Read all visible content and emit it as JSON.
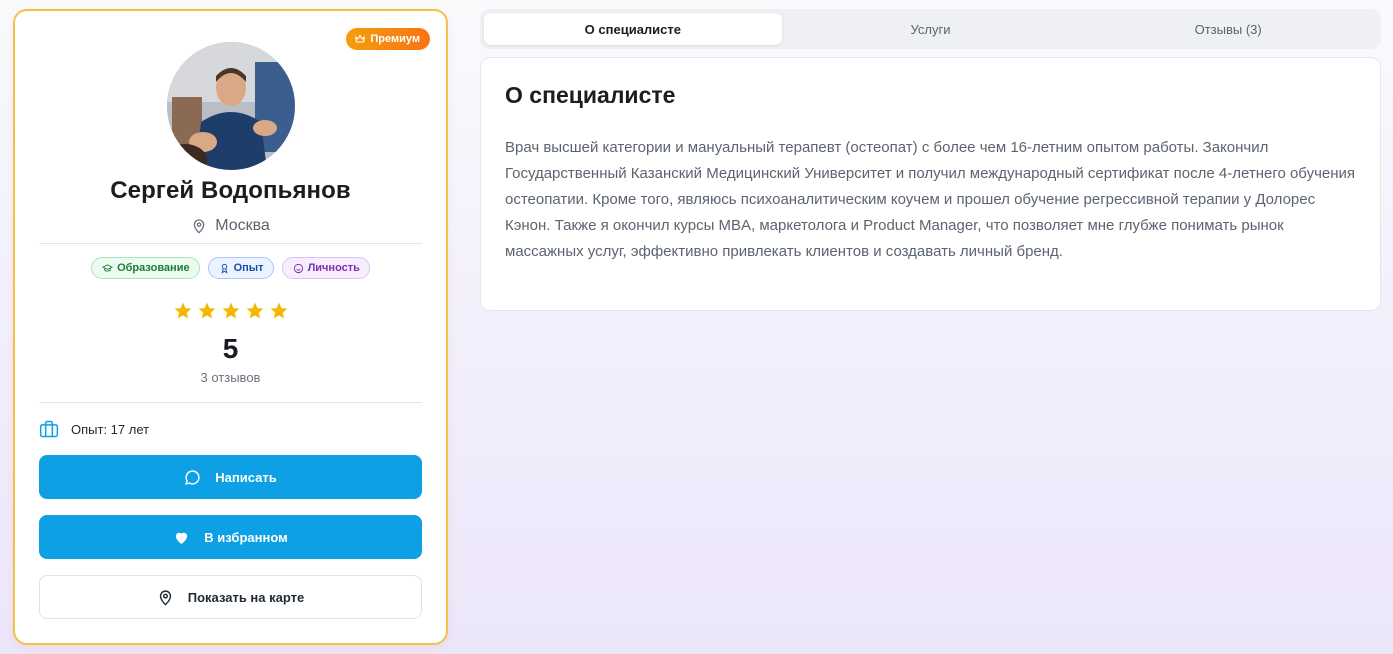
{
  "profile": {
    "premium_label": "Премиум",
    "name": "Сергей Водопьянов",
    "city": "Москва",
    "tags": [
      {
        "label": "Образование",
        "icon": "graduation-cap-icon"
      },
      {
        "label": "Опыт",
        "icon": "award-icon"
      },
      {
        "label": "Личность",
        "icon": "smile-icon"
      }
    ],
    "rating": {
      "stars": 5,
      "max": 5,
      "value": "5",
      "reviews_label": "3 отзывов"
    },
    "experience_label": "Опыт: 17 лет",
    "buttons": {
      "message": "Написать",
      "favorite": "В избранном",
      "map": "Показать на карте"
    }
  },
  "tabs": [
    {
      "label": "О специалисте",
      "active": true
    },
    {
      "label": "Услуги",
      "active": false
    },
    {
      "label": "Отзывы (3)",
      "active": false
    }
  ],
  "about": {
    "title": "О специалисте",
    "text": "Врач высшей категории и мануальный терапевт (остеопат) с более чем 16-летним опытом работы. Закончил Государственный Казанский Медицинский Университет и получил международный сертификат после 4-летнего обучения остеопатии. Кроме того, являюсь психоаналитическим коучем и прошел обучение регрессивной терапии у Долорес Кэнон. Также я окончил курсы MBA, маркетолога и Product Manager, что позволяет мне глубже понимать рынок массажных услуг, эффективно привлекать клиентов и создавать личный бренд."
  },
  "colors": {
    "accent": "#0ea0e4",
    "premium": "#f59e0b",
    "star": "#f5b800",
    "card_border": "#f5c04a"
  }
}
